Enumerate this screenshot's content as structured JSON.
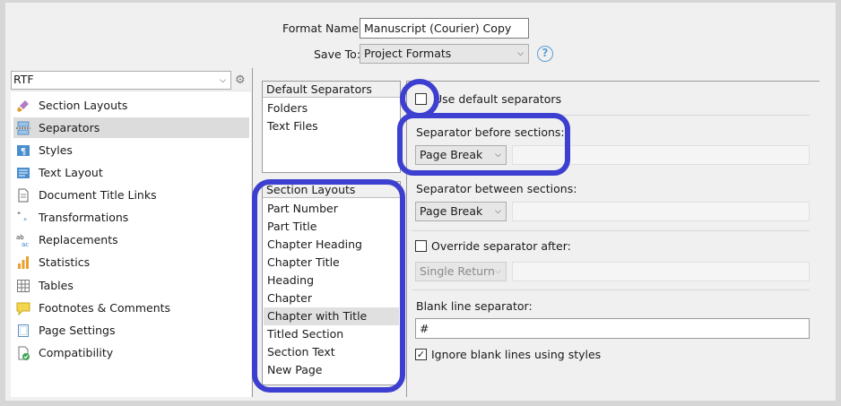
{
  "header": {
    "format_name_label": "Format Name:",
    "format_name_value": "Manuscript (Courier) Copy",
    "save_to_label": "Save To:",
    "save_to_value": "Project Formats",
    "help_glyph": "?"
  },
  "sidebar": {
    "format_select": "RTF",
    "items": [
      {
        "label": "Section Layouts",
        "icon": "brush-icon"
      },
      {
        "label": "Separators",
        "icon": "separator-icon"
      },
      {
        "label": "Styles",
        "icon": "paragraph-icon"
      },
      {
        "label": "Text Layout",
        "icon": "text-layout-icon"
      },
      {
        "label": "Document Title Links",
        "icon": "document-icon"
      },
      {
        "label": "Transformations",
        "icon": "quotes-icon"
      },
      {
        "label": "Replacements",
        "icon": "replace-icon"
      },
      {
        "label": "Statistics",
        "icon": "bar-chart-icon"
      },
      {
        "label": "Tables",
        "icon": "table-icon"
      },
      {
        "label": "Footnotes & Comments",
        "icon": "comment-icon"
      },
      {
        "label": "Page Settings",
        "icon": "page-icon"
      },
      {
        "label": "Compatibility",
        "icon": "compatibility-icon"
      }
    ],
    "selected_index": 1
  },
  "default_separators": {
    "header": "Default Separators",
    "items": [
      "Folders",
      "Text Files"
    ]
  },
  "section_layouts": {
    "header": "Section Layouts",
    "items": [
      "Part Number",
      "Part Title",
      "Chapter Heading",
      "Chapter Title",
      "Heading",
      "Chapter",
      "Chapter with Title",
      "Titled Section",
      "Section Text",
      "New Page"
    ],
    "selected_index": 6
  },
  "options": {
    "use_default_label": "Use default separators",
    "use_default_checked": false,
    "before_label": "Separator before sections:",
    "before_value": "Page Break",
    "between_label": "Separator between sections:",
    "between_value": "Page Break",
    "override_label": "Override separator after:",
    "override_checked": false,
    "override_value": "Single Return",
    "blank_line_label": "Blank line separator:",
    "blank_line_value": "#",
    "ignore_blank_label": "Ignore blank lines using styles",
    "ignore_blank_checked": true
  },
  "colors": {
    "highlight": "#3d3fd0",
    "selected_row": "#dcdcdc",
    "help_blue": "#5aa0d8"
  }
}
